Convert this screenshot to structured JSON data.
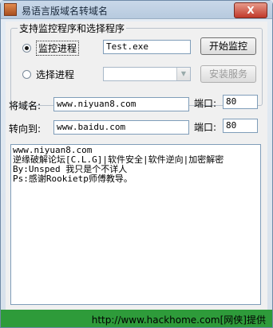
{
  "window": {
    "title": "易语言版域名转域名",
    "close_glyph": "X"
  },
  "group": {
    "legend": "支持监控程序和选择程序",
    "radio_monitor_label": "监控进程",
    "radio_select_label": "选择进程",
    "process_value": "Test.exe",
    "start_button": "开始监控",
    "install_button": "安装服务"
  },
  "domain": {
    "source_label": "将域名:",
    "source_value": "www.niyuan8.com",
    "source_port_label": "端口:",
    "source_port_value": "80",
    "target_label": "转向到:",
    "target_value": "www.baidu.com",
    "target_port_label": "端口:",
    "target_port_value": "80"
  },
  "memo": {
    "lines": [
      "www.niyuan8.com",
      "逆缘破解论坛[C.L.G]|软件安全|软件逆向|加密解密",
      "By:Unsped 我只是个不详人",
      "Ps:感谢Rookietp师傅教导。"
    ]
  },
  "status": {
    "text": "http://www.hackhome.com[网侠]提供"
  }
}
